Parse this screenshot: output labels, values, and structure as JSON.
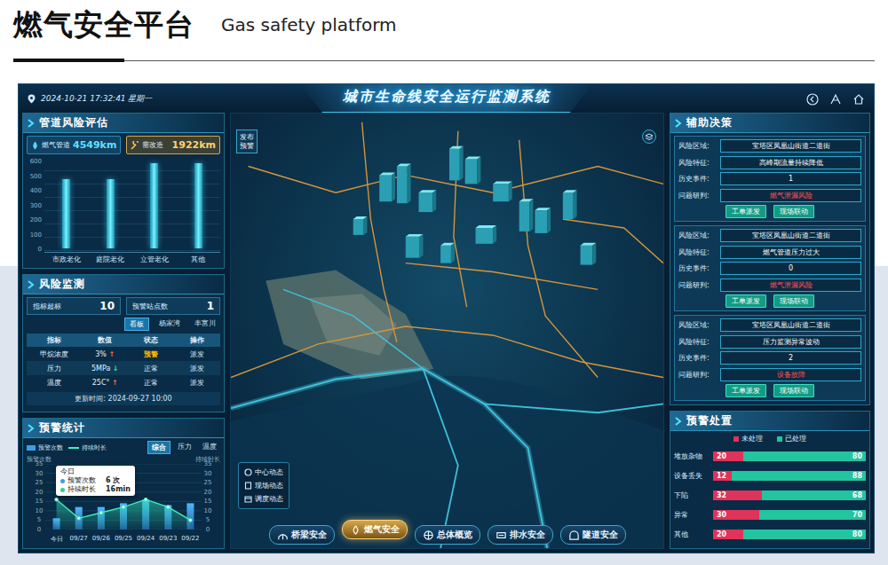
{
  "page": {
    "title": "燃气安全平台",
    "subtitle": "Gas safety platform"
  },
  "topbar": {
    "datetime": "2024-10-21 17:32:41 星期一",
    "title": "城市生命线安全运行监测系统"
  },
  "pipeline_risk": {
    "title": "管道风险评估",
    "stats": [
      {
        "label": "燃气管道",
        "value": "4549km",
        "selected": false
      },
      {
        "label": "需改造",
        "value": "1922km",
        "selected": true
      }
    ],
    "chart": {
      "ticks": [
        "600",
        "500",
        "400",
        "300",
        "200",
        "100",
        "0"
      ],
      "max": 600,
      "categories": [
        "市政老化",
        "庭院老化",
        "立管老化",
        "其他"
      ],
      "values": [
        480,
        480,
        590,
        590
      ]
    }
  },
  "risk_monitor": {
    "title": "风险监测",
    "stats": [
      {
        "label": "指标超标",
        "value": "10"
      },
      {
        "label": "预警站点数",
        "value": "1"
      }
    ],
    "tabs": [
      {
        "label": "看板",
        "selected": true
      },
      {
        "label": "杨家湾",
        "selected": false
      },
      {
        "label": "丰富川",
        "selected": false
      }
    ],
    "columns": [
      "指标",
      "数值",
      "状态",
      "操作"
    ],
    "rows": [
      {
        "name": "甲烷浓度",
        "value": "3%",
        "trend": "↑",
        "rising": true,
        "status": "预警",
        "alert": true,
        "action": "派发"
      },
      {
        "name": "压力",
        "value": "5MPa",
        "trend": "↓",
        "rising": false,
        "status": "正常",
        "alert": false,
        "action": "派发"
      },
      {
        "name": "温度",
        "value": "25C°",
        "trend": "↑",
        "rising": true,
        "status": "正常",
        "alert": false,
        "action": "派发"
      }
    ],
    "updated": "更新时间: 2024-09-27 10:00"
  },
  "warning_stats": {
    "title": "预警统计",
    "legend": [
      "预警次数",
      "持续时长"
    ],
    "tabs": [
      {
        "label": "综合",
        "selected": true
      },
      {
        "label": "压力",
        "selected": false
      },
      {
        "label": "温度",
        "selected": false
      }
    ],
    "left_axis": "预警次数",
    "right_axis": "持续时长",
    "ticks": [
      "35",
      "30",
      "25",
      "20",
      "15",
      "10",
      "5",
      "0"
    ],
    "max": 35,
    "categories": [
      "今日",
      "09/27",
      "09/26",
      "09/25",
      "09/24",
      "09/23",
      "09/22"
    ],
    "counts": [
      6,
      12,
      12,
      14,
      16,
      13,
      14
    ],
    "durations": [
      16,
      6,
      9,
      12,
      16,
      12,
      5
    ],
    "tooltip": {
      "title": "今日",
      "rows": [
        {
          "label": "预警次数",
          "value": "6 次"
        },
        {
          "label": "持续时长",
          "value": "16min"
        }
      ]
    }
  },
  "map": {
    "publish_button": "发布预警",
    "dynamics": [
      "中心动态",
      "现场动态",
      "调度动态"
    ],
    "nav": [
      {
        "label": "桥梁安全",
        "selected": false
      },
      {
        "label": "燃气安全",
        "selected": true
      },
      {
        "label": "总体概览",
        "selected": false
      },
      {
        "label": "排水安全",
        "selected": false
      },
      {
        "label": "隧道安全",
        "selected": false
      }
    ]
  },
  "decision": {
    "title": "辅助决策",
    "field_labels": [
      "风险区域:",
      "风险特征:",
      "历史事件:",
      "问题研判:"
    ],
    "cards": [
      {
        "area": "宝塔区凤凰山街道二道街",
        "feature": "高峰期流量持续降低",
        "history": "1",
        "judgement": "燃气泄漏风险",
        "buttons": [
          "工单派发",
          "现场联动"
        ]
      },
      {
        "area": "宝塔区凤凰山街道二道街",
        "feature": "燃气管道压力过大",
        "history": "0",
        "judgement": "燃气泄漏风险",
        "buttons": [
          "工单派发",
          "现场联动"
        ]
      },
      {
        "area": "宝塔区凤凰山街道二道街",
        "feature": "压力监测异常波动",
        "history": "2",
        "judgement": "设备故障",
        "buttons": [
          "工单派发",
          "现场联动"
        ]
      }
    ]
  },
  "disposal": {
    "title": "预警处置",
    "legend": [
      {
        "label": "未处理",
        "color": "#e0335a"
      },
      {
        "label": "已处理",
        "color": "#23c4a0"
      }
    ],
    "rows": [
      {
        "label": "堆放杂物",
        "pending": "20",
        "done": "80",
        "level": 0.2
      },
      {
        "label": "设备丢失",
        "pending": "12",
        "done": "88",
        "level": 0.12
      },
      {
        "label": "下陷",
        "pending": "32",
        "done": "68",
        "level": 0.32
      },
      {
        "label": "异常",
        "pending": "30",
        "done": "70",
        "level": 0.3
      },
      {
        "label": "其他",
        "pending": "20",
        "done": "80",
        "level": 0.2
      }
    ]
  }
}
